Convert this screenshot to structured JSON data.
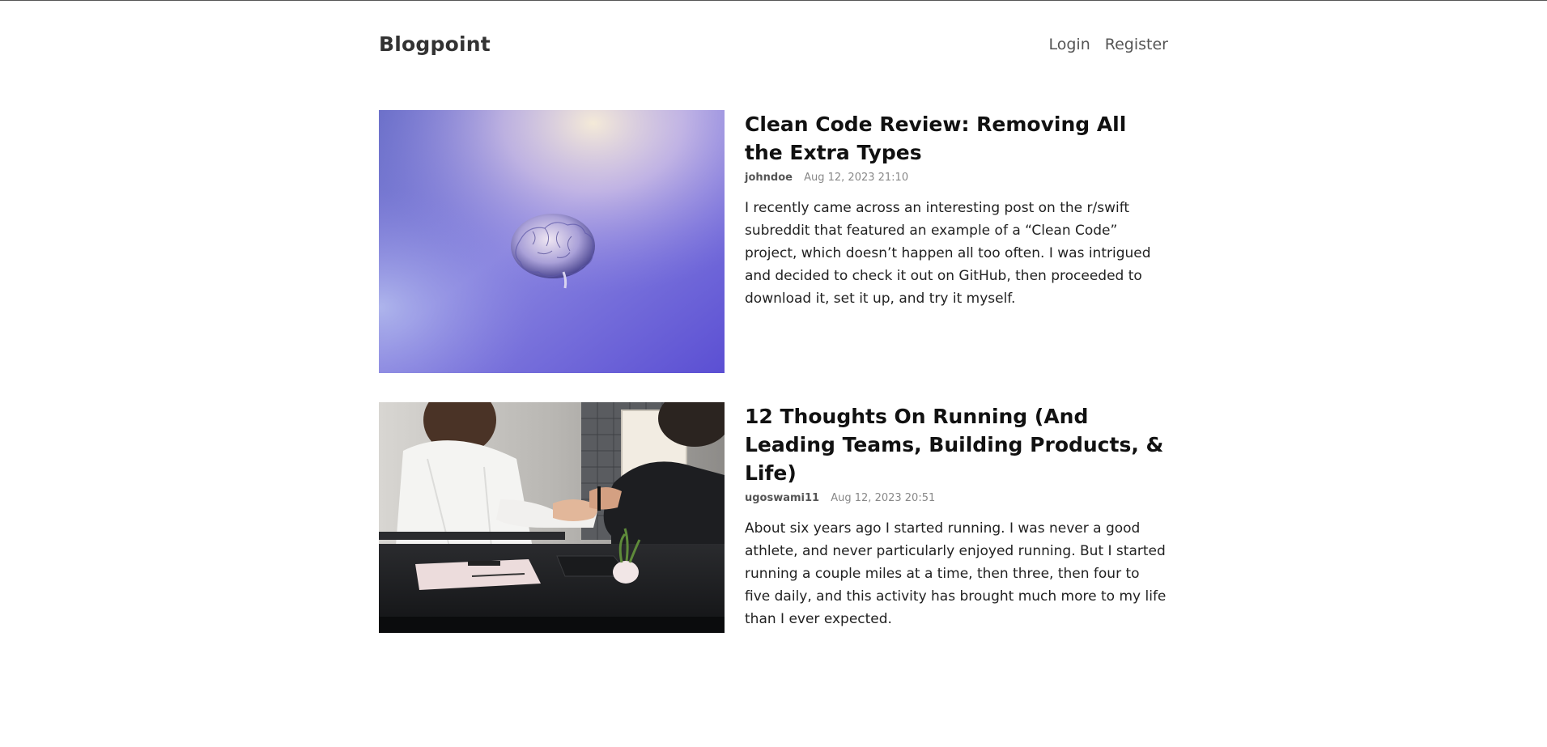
{
  "header": {
    "brand": "Blogpoint",
    "nav": {
      "login": "Login",
      "register": "Register"
    }
  },
  "posts": [
    {
      "title": "Clean Code Review: Removing All the Extra Types",
      "author": "johndoe",
      "date": "Aug 12, 2023 21:10",
      "excerpt": "I recently came across an interesting post on the r/swift subreddit that featured an example of a “Clean Code” project, which doesn’t happen all too often. I was intrigued and decided to check it out on GitHub, then proceeded to download it, set it up, and try it myself."
    },
    {
      "title": "12 Thoughts On Running (And Leading Teams, Building Products, & Life)",
      "author": "ugoswami11",
      "date": "Aug 12, 2023 20:51",
      "excerpt": "About six years ago I started running. I was never a good athlete, and never particularly enjoyed running. But I started running a couple miles at a time, then three, then four to five daily, and this activity has brought much more to my life than I ever expected."
    }
  ]
}
